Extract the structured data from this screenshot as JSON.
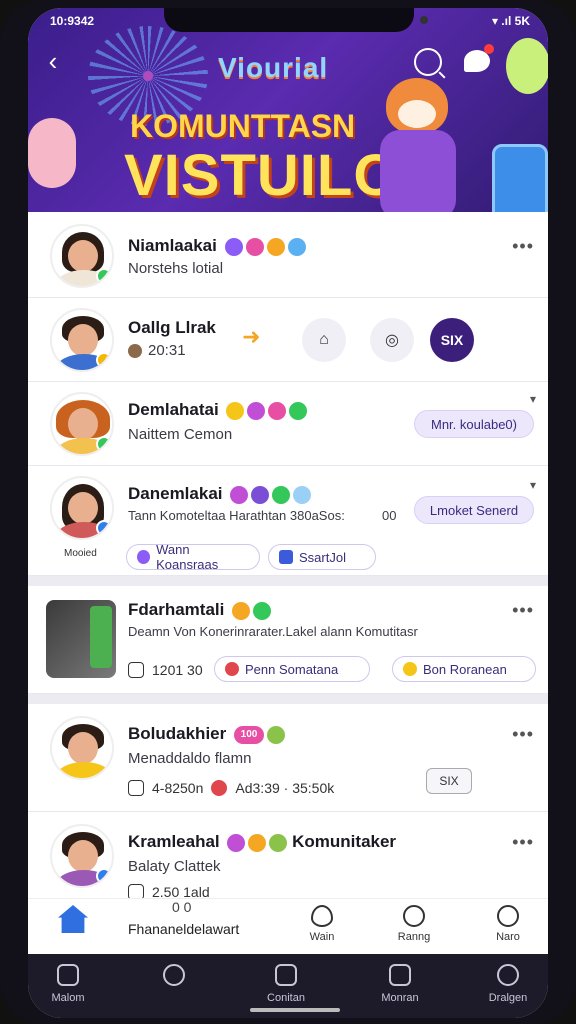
{
  "status": {
    "time": "10:9342",
    "right": "▾ .ıl 5K"
  },
  "hero": {
    "brand": "Viourial",
    "title_line1": "KOMUNTTASN",
    "title_line2": "VISTUILO"
  },
  "rows": [
    {
      "name": "Niamlaakai",
      "sub": "Norstehs lotial",
      "more": "•••"
    },
    {
      "name": "Oallg Llrak",
      "sub": "20:31",
      "action_label": "SIX"
    },
    {
      "name": "Demlahatai",
      "sub": "Naittem Cemon",
      "pill": "Mnr. koulabe0)"
    },
    {
      "name": "Danemlakai",
      "sub": "Tann Komoteltaa Harathtan 380aSos:",
      "sub2": "00",
      "pill": "Lmoket Senerd",
      "avatar_caption": "Mooied",
      "chips": [
        "Wann Koansraas",
        "SsartJol"
      ]
    },
    {
      "name": "Fdarhamtali",
      "sub": "Deamn Von Konerinrarater.Lakel alann Komutitasr",
      "meta": "1201 30",
      "chips": [
        "Penn Somatana",
        "Bon Roranean"
      ],
      "more": "•••"
    },
    {
      "name": "Boludakhier",
      "badge": "100",
      "sub": "Menaddaldo flamn",
      "meta": "4-8250n",
      "meta2": "Ad3:39 · 35:50k",
      "button": "SIX",
      "more": "•••"
    },
    {
      "name": "Kramleahal",
      "tag": "Komunitaker",
      "sub": "Balaty Clattek",
      "meta": "2.50 1ald",
      "more": "•••"
    }
  ],
  "inner_tab": {
    "label": "Fhananeldelawart",
    "count": "0 0",
    "items": [
      "Wain",
      "Ranng",
      "Naro"
    ]
  },
  "bottom_nav": [
    "Malom",
    "",
    "Conitan",
    "Monran",
    "Dralgen"
  ]
}
